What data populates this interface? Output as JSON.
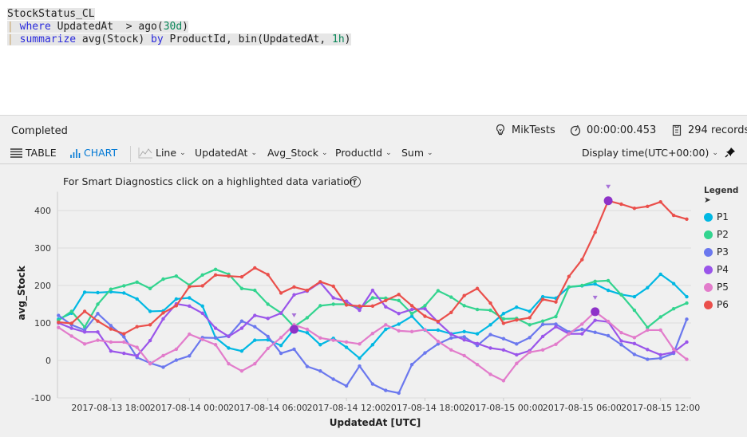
{
  "query": {
    "lines": [
      [
        {
          "t": "StockStatus_CL",
          "c": ""
        }
      ],
      [
        {
          "t": "| ",
          "c": "pipe"
        },
        {
          "t": "where",
          "c": "kw"
        },
        {
          "t": " UpdatedAt  > ago(",
          "c": ""
        },
        {
          "t": "30d",
          "c": "num"
        },
        {
          "t": ")",
          "c": ""
        }
      ],
      [
        {
          "t": "| ",
          "c": "pipe"
        },
        {
          "t": "summarize",
          "c": "kw"
        },
        {
          "t": " avg(Stock) ",
          "c": ""
        },
        {
          "t": "by",
          "c": "kw"
        },
        {
          "t": " ProductId, bin(UpdatedAt, ",
          "c": ""
        },
        {
          "t": "1h",
          "c": "num"
        },
        {
          "t": ")",
          "c": ""
        }
      ]
    ]
  },
  "status": {
    "state": "Completed",
    "workspace": "MikTests",
    "duration": "00:00:00.453",
    "records": "294 records"
  },
  "toolbar": {
    "table": "TABLE",
    "chart": "CHART",
    "chart_type": "Line",
    "x_column": "UpdatedAt",
    "y_column": "Avg_Stock",
    "split_by": "ProductId",
    "aggregation": "Sum",
    "display_time": "Display time(UTC+00:00)",
    "accent": "#0078d4"
  },
  "hint": "For Smart Diagnostics click on a highlighted data variation",
  "help_icon": "?",
  "chart_data": {
    "type": "line",
    "xlabel": "UpdatedAt [UTC]",
    "ylabel": "avg_Stock",
    "x_start": "2017-08-13 14:00",
    "x_step": "1h",
    "x_ticks": [
      "2017-08-13 18:00",
      "2017-08-14 00:00",
      "2017-08-14 06:00",
      "2017-08-14 12:00",
      "2017-08-14 18:00",
      "2017-08-15 00:00",
      "2017-08-15 06:00",
      "2017-08-15 12:00"
    ],
    "y_ticks": [
      -100,
      0,
      100,
      200,
      300,
      400
    ],
    "ylim": [
      -100,
      450
    ],
    "grid": "horizontal",
    "legend_title": "Legend",
    "legend_position": "right",
    "series": [
      {
        "name": "P1",
        "color": "#01b8e3",
        "values": [
          110,
          126,
          182,
          181,
          183,
          180,
          164,
          131,
          132,
          164,
          167,
          145,
          61,
          33,
          25,
          54,
          55,
          40,
          83,
          74,
          42,
          59,
          35,
          6,
          42,
          83,
          97,
          118,
          81,
          81,
          71,
          77,
          71,
          95,
          125,
          142,
          131,
          170,
          166,
          196,
          199,
          204,
          187,
          176,
          170,
          194,
          230,
          205,
          170
        ]
      },
      {
        "name": "P2",
        "color": "#33d48f",
        "values": [
          107,
          131,
          89,
          150,
          190,
          199,
          209,
          192,
          217,
          225,
          201,
          228,
          243,
          230,
          192,
          187,
          150,
          127,
          90,
          114,
          146,
          150,
          150,
          139,
          167,
          166,
          160,
          125,
          146,
          186,
          169,
          146,
          136,
          134,
          111,
          112,
          95,
          105,
          117,
          196,
          200,
          211,
          213,
          175,
          134,
          88,
          116,
          138,
          153
        ]
      },
      {
        "name": "P3",
        "color": "#6b78ee",
        "values": [
          120,
          95,
          81,
          125,
          93,
          63,
          8,
          -7,
          -18,
          1,
          12,
          61,
          60,
          65,
          105,
          90,
          64,
          19,
          30,
          -16,
          -28,
          -50,
          -68,
          -15,
          -63,
          -80,
          -87,
          -11,
          20,
          44,
          60,
          63,
          40,
          69,
          58,
          44,
          61,
          96,
          97,
          76,
          83,
          75,
          66,
          42,
          16,
          3,
          6,
          19,
          110
        ]
      },
      {
        "name": "P4",
        "color": "#9a55ea",
        "values": [
          100,
          86,
          76,
          76,
          25,
          19,
          12,
          53,
          111,
          151,
          145,
          126,
          86,
          64,
          86,
          120,
          112,
          126,
          175,
          185,
          208,
          167,
          158,
          134,
          187,
          143,
          125,
          136,
          138,
          102,
          70,
          55,
          45,
          33,
          28,
          15,
          26,
          64,
          90,
          71,
          71,
          107,
          103,
          52,
          45,
          29,
          15,
          22,
          49
        ]
      },
      {
        "name": "P5",
        "color": "#e27ccb",
        "values": [
          88,
          65,
          44,
          54,
          49,
          49,
          35,
          -9,
          13,
          30,
          70,
          56,
          42,
          -9,
          -28,
          -9,
          32,
          61,
          95,
          83,
          60,
          54,
          49,
          44,
          72,
          95,
          79,
          77,
          82,
          51,
          28,
          13,
          -11,
          -37,
          -54,
          -8,
          22,
          28,
          43,
          71,
          97,
          130,
          104,
          74,
          61,
          81,
          81,
          30,
          3
        ]
      },
      {
        "name": "P6",
        "color": "#ea4f4b",
        "values": [
          102,
          99,
          131,
          105,
          84,
          71,
          90,
          95,
          127,
          146,
          197,
          199,
          228,
          225,
          223,
          247,
          229,
          180,
          196,
          187,
          210,
          198,
          148,
          145,
          145,
          160,
          176,
          146,
          118,
          104,
          128,
          173,
          192,
          153,
          99,
          108,
          114,
          163,
          156,
          224,
          269,
          342,
          426,
          417,
          406,
          411,
          423,
          387,
          377
        ]
      }
    ],
    "anomalies": [
      {
        "series": "P4",
        "x": "2017-08-14 08:00",
        "value": 83
      },
      {
        "series": "P5",
        "x": "2017-08-15 07:00",
        "value": 130
      },
      {
        "series": "P6",
        "x": "2017-08-15 08:00",
        "value": 426
      }
    ],
    "anomaly_color": "#8e32c8"
  }
}
